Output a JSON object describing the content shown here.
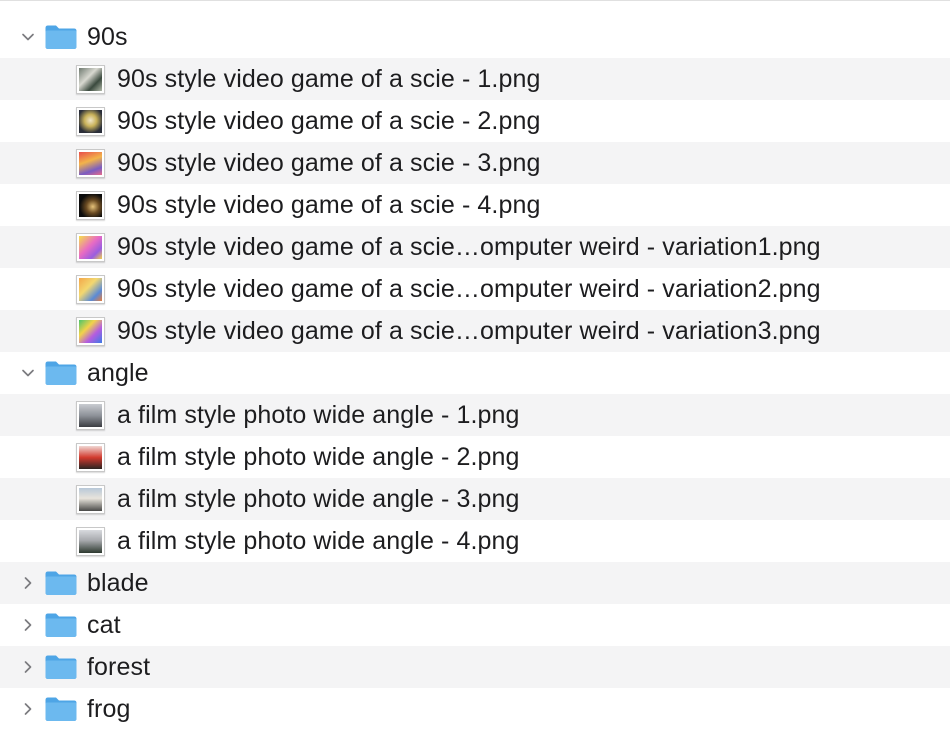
{
  "colors": {
    "folder_blue": "#6cb9ef",
    "folder_blue_dark": "#4ea5e6",
    "row_alt": "#f4f4f5",
    "chevron": "#7b7b7f"
  },
  "tree": [
    {
      "type": "folder",
      "name": "90s",
      "expanded": true,
      "icon": "folder-icon",
      "files": [
        {
          "name": "90s style video game of a scie - 1.png",
          "thumb": "pixel-scientist-grey"
        },
        {
          "name": "90s style video game of a scie - 2.png",
          "thumb": "pixel-scientist-yellow"
        },
        {
          "name": "90s style video game of a scie - 3.png",
          "thumb": "pixel-scientist-red"
        },
        {
          "name": "90s style video game of a scie - 4.png",
          "thumb": "pixel-scientist-dark"
        },
        {
          "name": "90s style video game of a scie…omputer weird - variation1.png",
          "thumb": "pixel-scientist-purple"
        },
        {
          "name": "90s style video game of a scie…omputer weird - variation2.png",
          "thumb": "pixel-scientist-orange"
        },
        {
          "name": "90s style video game of a scie…omputer weird - variation3.png",
          "thumb": "pixel-scientist-green"
        }
      ]
    },
    {
      "type": "folder",
      "name": "angle",
      "expanded": true,
      "icon": "folder-icon",
      "files": [
        {
          "name": "a film style photo wide angle  - 1.png",
          "thumb": "photo-cat-grey"
        },
        {
          "name": "a film style photo wide angle  - 2.png",
          "thumb": "photo-cat-red"
        },
        {
          "name": "a film style photo wide angle  - 3.png",
          "thumb": "photo-cat-sky"
        },
        {
          "name": "a film style photo wide angle  - 4.png",
          "thumb": "photo-cat-dark"
        }
      ]
    },
    {
      "type": "folder",
      "name": "blade",
      "expanded": false,
      "icon": "folder-icon",
      "files": []
    },
    {
      "type": "folder",
      "name": "cat",
      "expanded": false,
      "icon": "folder-icon",
      "files": []
    },
    {
      "type": "folder",
      "name": "forest",
      "expanded": false,
      "icon": "folder-icon",
      "files": []
    },
    {
      "type": "folder",
      "name": "frog",
      "expanded": false,
      "icon": "folder-icon",
      "files": []
    }
  ]
}
